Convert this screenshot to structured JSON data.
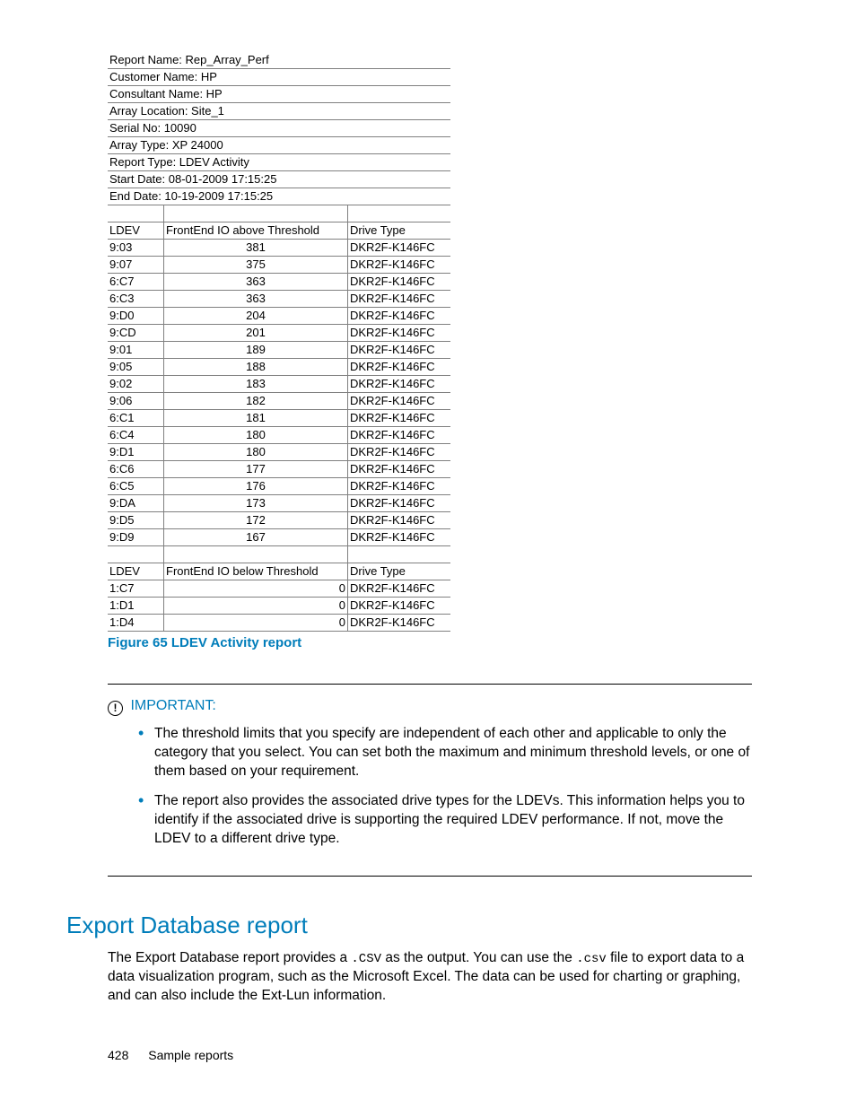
{
  "report": {
    "meta": [
      "Report Name: Rep_Array_Perf",
      "Customer Name: HP",
      "Consultant Name: HP",
      "Array Location: Site_1",
      "Serial No: 10090",
      "Array Type: XP 24000",
      "Report Type: LDEV Activity",
      "Start Date: 08-01-2009 17:15:25",
      "End Date: 10-19-2009 17:15:25"
    ],
    "above": {
      "h1": "LDEV",
      "h2": "FrontEnd IO above Threshold",
      "h3": "Drive Type",
      "rows": [
        {
          "ldev": "9:03",
          "val": "381",
          "drv": "DKR2F-K146FC"
        },
        {
          "ldev": "9:07",
          "val": "375",
          "drv": "DKR2F-K146FC"
        },
        {
          "ldev": "6:C7",
          "val": "363",
          "drv": "DKR2F-K146FC"
        },
        {
          "ldev": "6:C3",
          "val": "363",
          "drv": "DKR2F-K146FC"
        },
        {
          "ldev": "9:D0",
          "val": "204",
          "drv": "DKR2F-K146FC"
        },
        {
          "ldev": "9:CD",
          "val": "201",
          "drv": "DKR2F-K146FC"
        },
        {
          "ldev": "9:01",
          "val": "189",
          "drv": "DKR2F-K146FC"
        },
        {
          "ldev": "9:05",
          "val": "188",
          "drv": "DKR2F-K146FC"
        },
        {
          "ldev": "9:02",
          "val": "183",
          "drv": "DKR2F-K146FC"
        },
        {
          "ldev": "9:06",
          "val": "182",
          "drv": "DKR2F-K146FC"
        },
        {
          "ldev": "6:C1",
          "val": "181",
          "drv": "DKR2F-K146FC"
        },
        {
          "ldev": "6:C4",
          "val": "180",
          "drv": "DKR2F-K146FC"
        },
        {
          "ldev": "9:D1",
          "val": "180",
          "drv": "DKR2F-K146FC"
        },
        {
          "ldev": "6:C6",
          "val": "177",
          "drv": "DKR2F-K146FC"
        },
        {
          "ldev": "6:C5",
          "val": "176",
          "drv": "DKR2F-K146FC"
        },
        {
          "ldev": "9:DA",
          "val": "173",
          "drv": "DKR2F-K146FC"
        },
        {
          "ldev": "9:D5",
          "val": "172",
          "drv": "DKR2F-K146FC"
        },
        {
          "ldev": "9:D9",
          "val": "167",
          "drv": "DKR2F-K146FC"
        }
      ]
    },
    "below": {
      "h1": "LDEV",
      "h2": "FrontEnd IO below Threshold",
      "h3": "Drive Type",
      "rows": [
        {
          "ldev": "1:C7",
          "val": "0",
          "drv": "DKR2F-K146FC"
        },
        {
          "ldev": "1:D1",
          "val": "0",
          "drv": "DKR2F-K146FC"
        },
        {
          "ldev": "1:D4",
          "val": "0",
          "drv": "DKR2F-K146FC"
        }
      ]
    }
  },
  "caption": "Figure 65 LDEV Activity report",
  "important": {
    "label": "IMPORTANT:",
    "items": [
      "The threshold limits that you specify are independent of each other and applicable to only the category that you select. You can set both the maximum and minimum threshold levels, or one of them based on your requirement.",
      "The report also provides the associated drive types for the LDEVs. This information helps you to identify if the associated drive is supporting the required LDEV performance. If not, move the LDEV to a different drive type."
    ]
  },
  "section": {
    "heading": "Export Database report",
    "para_pre": "The Export Database report provides a ",
    "code1": ".CSV",
    "para_mid": " as the output. You can use the ",
    "code2": ".csv",
    "para_post": " file to export data to a data visualization program, such as the Microsoft Excel. The data can be used for charting or graphing, and can also include the Ext-Lun information."
  },
  "footer": {
    "page": "428",
    "title": "Sample reports"
  }
}
